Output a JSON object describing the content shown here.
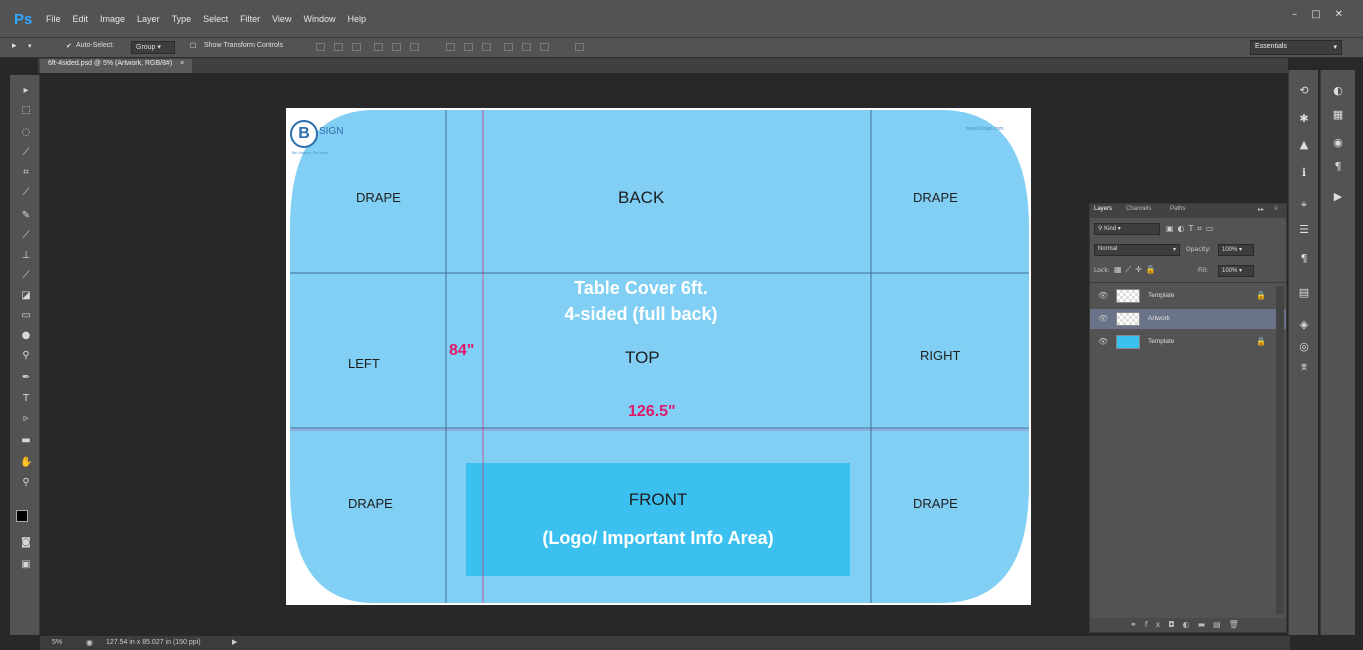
{
  "app": {
    "logo": "Ps"
  },
  "menu": [
    "File",
    "Edit",
    "Image",
    "Layer",
    "Type",
    "Select",
    "Filter",
    "View",
    "Window",
    "Help"
  ],
  "window_controls": {
    "minimize": "–",
    "restore": "□",
    "close": "✕"
  },
  "options": {
    "auto_select_label": "Auto-Select:",
    "auto_select_value": "Group",
    "show_transform_label": "Show Transform Controls",
    "workspace": "Essentials"
  },
  "document": {
    "tab_title": "6ft-4sided.psd @ 5% (Artwork, RGB/8#)",
    "tab_close": "×"
  },
  "artwork": {
    "logo_letter": "B",
    "logo_text": "SIGN",
    "logo_tagline": "Be Unique. Be Seen.",
    "website": "www.b3sign.com",
    "drape_tl": "DRAPE",
    "back": "BACK",
    "drape_tr": "DRAPE",
    "title_line1": "Table Cover 6ft.",
    "title_line2": "4-sided (full back)",
    "left": "LEFT",
    "height_dim": "84\"",
    "top": "TOP",
    "right": "RIGHT",
    "width_dim": "126.5\"",
    "drape_bl": "DRAPE",
    "front": "FRONT",
    "front_sub": "(Logo/ Important Info Area)",
    "drape_br": "DRAPE"
  },
  "layers_panel": {
    "tabs": [
      "Layers",
      "Channels",
      "Paths"
    ],
    "kind": "Kind",
    "blend_mode": "Normal",
    "opacity_label": "Opacity:",
    "opacity": "100%",
    "lock_label": "Lock:",
    "fill_label": "Fill:",
    "fill": "100%",
    "layers": [
      {
        "name": "Template",
        "locked": true
      },
      {
        "name": "Artwork",
        "locked": false,
        "selected": true
      },
      {
        "name": "Template",
        "locked": true
      }
    ]
  },
  "status": {
    "zoom": "5%",
    "doc_size": "127.54 in x 85.027 in (150 ppi)"
  },
  "colors": {
    "panel": "#535353",
    "workspace": "#282828",
    "artwork_fill": "#81cff4",
    "front_fill": "#3cc0ef",
    "dimension": "#e0196b"
  }
}
